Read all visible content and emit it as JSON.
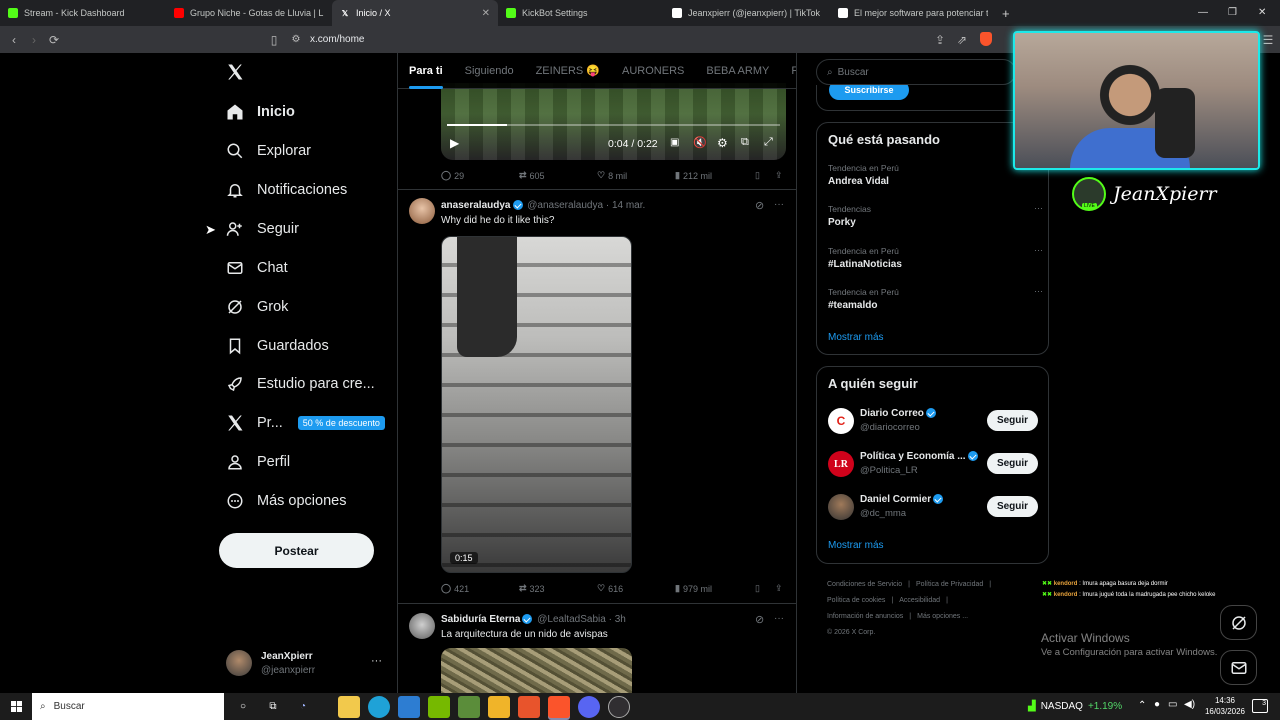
{
  "browser": {
    "tabs": [
      {
        "title": "Stream - Kick Dashboard",
        "icon": "kick-icon",
        "color": "#53fc18"
      },
      {
        "title": "Grupo Niche - Gotas de Lluvia | L",
        "icon": "youtube-icon",
        "color": "#ff0000"
      },
      {
        "title": "Inicio / X",
        "icon": "x-icon",
        "color": "#ffffff",
        "active": true
      },
      {
        "title": "KickBot Settings",
        "icon": "kick-icon",
        "color": "#53fc18"
      },
      {
        "title": "Jeanxpierr (@jeanxpierr) | TikTok",
        "icon": "tiktok-icon",
        "color": "#ffffff"
      },
      {
        "title": "El mejor software para potenciar tu s",
        "icon": "diamond-icon",
        "color": "#ffffff"
      }
    ],
    "url": "x.com/home"
  },
  "nav": {
    "items": [
      "Inicio",
      "Explorar",
      "Notificaciones",
      "Seguir",
      "Chat",
      "Grok",
      "Guardados",
      "Estudio para cre...",
      "Pr...",
      "Perfil",
      "Más opciones"
    ],
    "premium_badge": "50 % de descuento",
    "post_button": "Postear",
    "account_name": "JeanXpierr",
    "account_handle": "@jeanxpierr",
    "more": "···"
  },
  "feed": {
    "tabs": [
      "Para ti",
      "Siguiendo",
      "ZEINERS 😝",
      "AURONERS",
      "BEBA ARMY",
      "Fiel Arm"
    ],
    "video1": {
      "time": "0:04 / 0:22",
      "progress": 0.18
    },
    "post0_actions": {
      "replies": "29",
      "reposts": "605",
      "likes": "8 mil",
      "views": "212 mil"
    },
    "post1": {
      "name": "anaseralaudya",
      "handle": "@anaseralaudya",
      "date": "14 mar.",
      "text": "Why did he do it like this?",
      "duration": "0:15",
      "replies": "421",
      "reposts": "323",
      "likes": "616",
      "views": "979 mil"
    },
    "post2": {
      "name": "Sabiduría Eterna",
      "handle": "@LealtadSabia",
      "date": "3h",
      "text": "La arquitectura de un nido de avispas"
    },
    "dot": "·",
    "more": "···"
  },
  "right": {
    "search_placeholder": "Buscar",
    "subscribe": "Suscribirse",
    "trends_title": "Qué está pasando",
    "trends": [
      {
        "context": "Tendencia en Perú",
        "name": "Andrea Vidal"
      },
      {
        "context": "Tendencias",
        "name": "Porky"
      },
      {
        "context": "Tendencia en Perú",
        "name": "#LatinaNoticias"
      },
      {
        "context": "Tendencia en Perú",
        "name": "#teamaldo"
      }
    ],
    "show_more": "Mostrar más",
    "follow_title": "A quién seguir",
    "follow": [
      {
        "name": "Diario Correo",
        "handle": "@diariocorreo",
        "button": "Seguir",
        "avatar": "C",
        "avatar_color": "#e2231a"
      },
      {
        "name": "Política y Economía ...",
        "handle": "@Politica_LR",
        "button": "Seguir",
        "avatar": "LR",
        "avatar_color": "#d0021b"
      },
      {
        "name": "Daniel Cormier",
        "handle": "@dc_mma",
        "button": "Seguir",
        "avatar": "",
        "avatar_color": "#555555"
      }
    ],
    "footer": [
      "Condiciones de Servicio",
      "Política de Privacidad",
      "Política de cookies",
      "Accesibilidad",
      "Información de anuncios",
      "Más opciones ...",
      "© 2026 X Corp."
    ]
  },
  "stream": {
    "name": "JeanXpierr",
    "live": "LIVE",
    "chat": [
      {
        "user": "kendord",
        "msg": "Imura apaga basura deja dormir"
      },
      {
        "user": "kendord",
        "msg": "Imura jugué toda la madrugada pee chicho keloke"
      }
    ]
  },
  "windows": {
    "activate_title": "Activar Windows",
    "activate_sub": "Ve a Configuración para activar Windows.",
    "search": "Buscar",
    "ticker_name": "NASDAQ",
    "ticker_value": "+1.19%",
    "time": "14:36",
    "date": "16/03/2026",
    "notif_count": "3"
  }
}
